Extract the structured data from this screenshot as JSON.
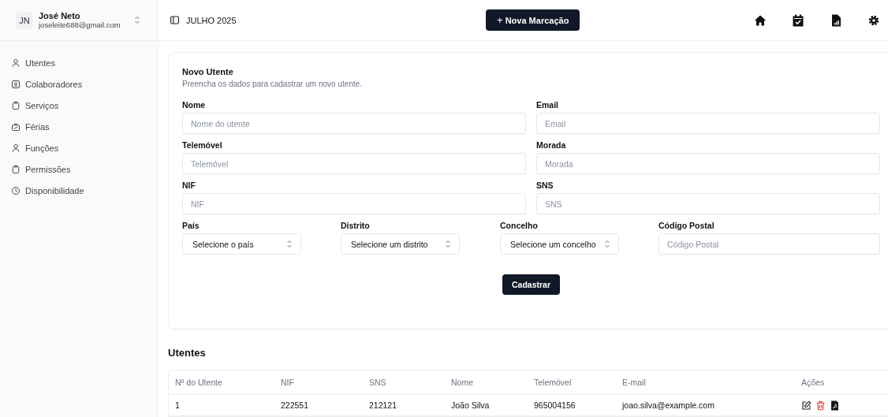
{
  "user": {
    "initials": "JN",
    "name": "José Neto",
    "email": "joseleite688@gmail.com"
  },
  "sidebar": {
    "items": [
      {
        "label": "Utentes"
      },
      {
        "label": "Colaboradores"
      },
      {
        "label": "Serviços"
      },
      {
        "label": "Férias"
      },
      {
        "label": "Funções"
      },
      {
        "label": "Permissões"
      },
      {
        "label": "Disponibilidade"
      }
    ]
  },
  "header": {
    "period": "JULHO 2025",
    "new_button": "Nova Marcação",
    "plus": "+"
  },
  "form": {
    "title": "Novo Utente",
    "subtitle": "Preencha os dados para cadastrar um novo utente.",
    "fields": [
      {
        "label": "Nome",
        "kind": "input",
        "placeholder": "Nome do utente"
      },
      {
        "label": "Email",
        "kind": "input",
        "placeholder": "Email"
      },
      {
        "label": "Telemóvel",
        "kind": "input",
        "placeholder": "Telemóvel"
      },
      {
        "label": "Morada",
        "kind": "input",
        "placeholder": "Morada"
      },
      {
        "label": "NIF",
        "kind": "input",
        "placeholder": "NIF"
      },
      {
        "label": "SNS",
        "kind": "input",
        "placeholder": "SNS"
      }
    ],
    "address_fields": [
      {
        "label": "País",
        "kind": "select",
        "value": "Selecione o país"
      },
      {
        "label": "Distrito",
        "kind": "select",
        "value": "Selecione um distrito"
      },
      {
        "label": "Concelho",
        "kind": "select",
        "value": "Selecione um concelho"
      },
      {
        "label": "Código Postal",
        "kind": "input",
        "placeholder": "Código Postal"
      }
    ],
    "submit": "Cadastrar"
  },
  "table": {
    "title": "Utentes",
    "columns": [
      "Nº do Utente",
      "NIF",
      "SNS",
      "Nome",
      "Telemóvel",
      "E-mail",
      "Ações"
    ],
    "rows": [
      {
        "cells": [
          "1",
          "222551",
          "212121",
          "João Silva",
          "965004156",
          "joao.silva@example.com"
        ]
      }
    ]
  }
}
